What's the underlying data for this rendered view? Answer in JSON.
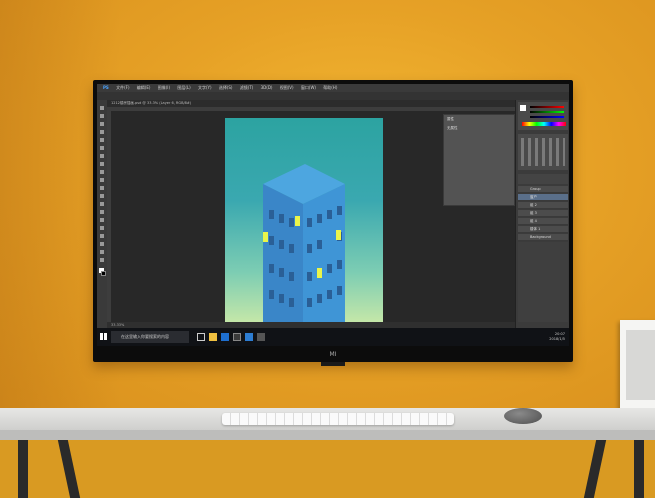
{
  "monitor": {
    "brand_mark": "MI"
  },
  "photoshop": {
    "menu_items": [
      "PS",
      "文件(F)",
      "编辑(E)",
      "图像(I)",
      "图层(L)",
      "文字(Y)",
      "选择(S)",
      "滤镜(T)",
      "3D(D)",
      "视图(V)",
      "窗口(W)",
      "帮助(H)"
    ],
    "tab_title": "1212楼房插画.psd @ 33.3% (Layer 6, RGB/8#)",
    "status_text": "33.33%",
    "float_panel": {
      "title": "属性",
      "subtitle": "无属性"
    },
    "layers": [
      {
        "name": "Group"
      },
      {
        "name": "窗户",
        "selected": true
      },
      {
        "name": "组 2"
      },
      {
        "name": "组 3"
      },
      {
        "name": "组 4"
      },
      {
        "name": "楼体 1"
      },
      {
        "name": "Background"
      }
    ]
  },
  "taskbar": {
    "search_placeholder": "在这里输入你要搜索的内容",
    "clock_time": "20:07",
    "clock_date": "2018/1/5"
  },
  "colors": {
    "wall": "#eaa62a",
    "building": "#3b8fd1",
    "window_lit": "#e8f24a",
    "artboard_top": "#2ca3a1",
    "artboard_bottom": "#c7e8a8"
  }
}
